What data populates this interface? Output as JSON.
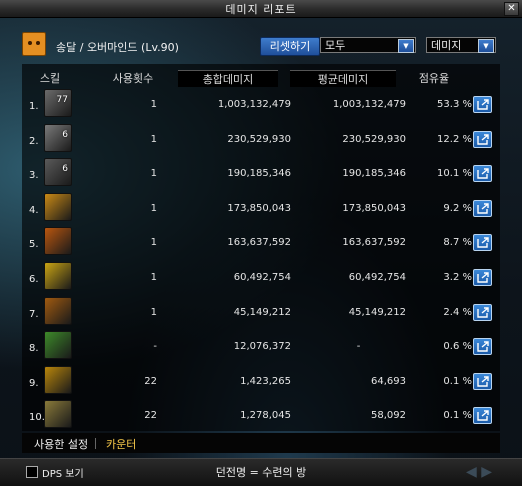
{
  "window": {
    "title": "데미지 리포트"
  },
  "character": {
    "name": "송달 / 오버마인드 (Lv.90)"
  },
  "controls": {
    "reset_label": "리셋하기",
    "target_select": "모두",
    "type_select": "데미지"
  },
  "columns": {
    "skill": "스킬",
    "uses": "사용횟수",
    "total": "총합데미지",
    "avg": "평균데미지",
    "share": "점유율"
  },
  "rows": [
    {
      "rank": "1.",
      "icon": "skill-icon-1",
      "icon_level": "77",
      "uses": "1",
      "total": "1,003,132,479",
      "avg": "1,003,132,479",
      "share": "53.3 %",
      "color": "#6b6b6b"
    },
    {
      "rank": "2.",
      "icon": "skill-icon-2",
      "icon_level": "6",
      "uses": "1",
      "total": "230,529,930",
      "avg": "230,529,930",
      "share": "12.2 %",
      "color": "#7a7a7a"
    },
    {
      "rank": "3.",
      "icon": "skill-icon-3",
      "icon_level": "6",
      "uses": "1",
      "total": "190,185,346",
      "avg": "190,185,346",
      "share": "10.1 %",
      "color": "#5a5a5a"
    },
    {
      "rank": "4.",
      "icon": "skill-icon-4",
      "icon_level": "",
      "uses": "1",
      "total": "173,850,043",
      "avg": "173,850,043",
      "share": "9.2 %",
      "color": "#c98a16"
    },
    {
      "rank": "5.",
      "icon": "skill-icon-5",
      "icon_level": "",
      "uses": "1",
      "total": "163,637,592",
      "avg": "163,637,592",
      "share": "8.7 %",
      "color": "#b9560f"
    },
    {
      "rank": "6.",
      "icon": "skill-icon-6",
      "icon_level": "",
      "uses": "1",
      "total": "60,492,754",
      "avg": "60,492,754",
      "share": "3.2 %",
      "color": "#c9a414"
    },
    {
      "rank": "7.",
      "icon": "skill-icon-7",
      "icon_level": "",
      "uses": "1",
      "total": "45,149,212",
      "avg": "45,149,212",
      "share": "2.4 %",
      "color": "#a05a10"
    },
    {
      "rank": "8.",
      "icon": "skill-icon-8",
      "icon_level": "",
      "uses": "-",
      "total": "12,076,372",
      "avg": "-",
      "share": "0.6 %",
      "color": "#3d8a2a"
    },
    {
      "rank": "9.",
      "icon": "skill-icon-9",
      "icon_level": "",
      "uses": "22",
      "total": "1,423,265",
      "avg": "64,693",
      "share": "0.1 %",
      "color": "#b8860b"
    },
    {
      "rank": "10.",
      "icon": "skill-icon-10",
      "icon_level": "",
      "uses": "22",
      "total": "1,278,045",
      "avg": "58,092",
      "share": "0.1 %",
      "color": "#8a7a3a"
    }
  ],
  "tabs": {
    "used_settings": "사용한 설정",
    "counter": "카운터"
  },
  "bottom": {
    "dps_label": "DPS 보기",
    "dungeon": "던전명 = 수련의 방"
  }
}
